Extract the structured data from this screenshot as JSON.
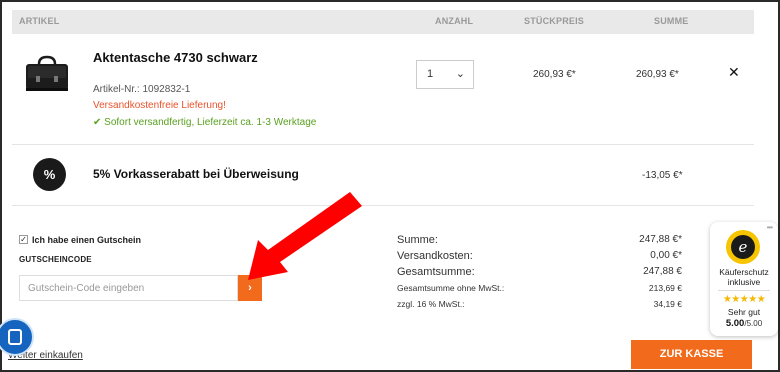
{
  "table_header": {
    "artikel": "ARTIKEL",
    "anzahl": "ANZAHL",
    "stueckpreis": "STÜCKPREIS",
    "summe": "SUMME"
  },
  "product": {
    "name": "Aktentasche 4730 schwarz",
    "article_no": "Artikel-Nr.: 1092832-1",
    "shipping_note": "Versandkostenfreie Lieferung!",
    "stock_note": "Sofort versandfertig, Lieferzeit ca. 1-3 Werktage",
    "quantity": "1",
    "unit_price": "260,93 €*",
    "total_price": "260,93 €*",
    "remove_symbol": "✕"
  },
  "discount": {
    "badge": "%",
    "label": "5% Vorkasserabatt bei Überweisung",
    "amount": "-13,05 €*"
  },
  "voucher": {
    "checkbox_label": "Ich habe einen Gutschein",
    "checked": true,
    "code_label": "GUTSCHEINCODE",
    "placeholder": "Gutschein-Code eingeben",
    "submit_symbol": "›"
  },
  "summary": {
    "rows": [
      {
        "label": "Summe:",
        "value": "247,88 €*"
      },
      {
        "label": "Versandkosten:",
        "value": "0,00 €*"
      },
      {
        "label": "Gesamtsumme:",
        "value": "247,88 €"
      },
      {
        "label": "Gesamtsumme ohne MwSt.:",
        "value": "213,69 €"
      },
      {
        "label": "zzgl. 16 % MwSt.:",
        "value": "34,19 €"
      }
    ]
  },
  "footer": {
    "continue_link": "Weiter einkaufen",
    "checkout_button": "ZUR KASSE"
  },
  "trusted_shops": {
    "seal_letter": "e",
    "protection": "Käuferschutz inklusive",
    "stars": "★★★★★",
    "rating_text": "Sehr gut",
    "score": "5.00",
    "score_max": "/5.00",
    "menu_dots": "•••"
  },
  "colors": {
    "accent": "#f26a1b",
    "annotation_arrow": "#ff0000",
    "shipping_note": "#e8532c",
    "stock_note": "#5aa021",
    "chat": "#1565c0"
  },
  "icons": {
    "quantity_dropdown": "chevron-down-icon",
    "stock": "check-icon",
    "remove": "close-icon",
    "voucher_submit": "chevron-right-icon",
    "chat": "chat-icon",
    "annotation": "red-arrow-icon"
  }
}
